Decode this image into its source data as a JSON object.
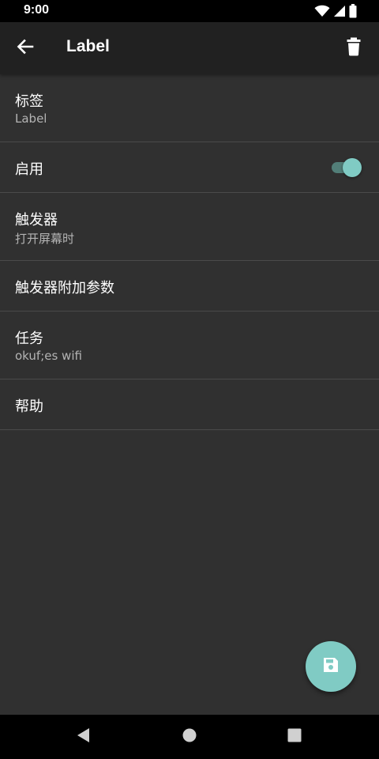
{
  "status_bar": {
    "time": "9:00",
    "icons": [
      "wifi-icon",
      "signal-icon",
      "battery-icon"
    ]
  },
  "app_bar": {
    "title": "Label",
    "back_icon": "arrow-back-icon",
    "delete_icon": "trash-icon"
  },
  "preferences": [
    {
      "title": "标签",
      "summary": "Label"
    },
    {
      "title": "启用",
      "switch_on": true
    },
    {
      "title": "触发器",
      "summary": "打开屏幕时"
    },
    {
      "title": "触发器附加参数"
    },
    {
      "title": "任务",
      "summary": "okuf;es wifi"
    },
    {
      "title": "帮助"
    }
  ],
  "fab": {
    "icon": "save-icon"
  },
  "nav_bar": {
    "icons": [
      "nav-back-icon",
      "nav-home-icon",
      "nav-recents-icon"
    ]
  },
  "colors": {
    "background": "#303030",
    "app_bar": "#212121",
    "accent": "#80cbc4",
    "divider": "#4a4a4a",
    "summary_text": "#b4b4b4"
  }
}
